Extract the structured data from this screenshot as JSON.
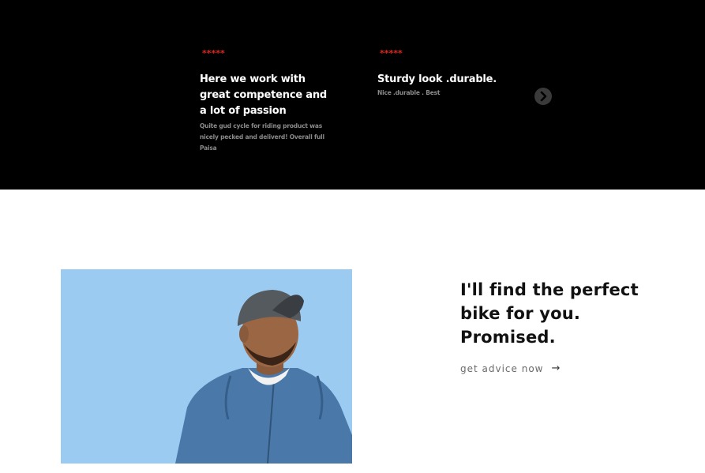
{
  "reviews": {
    "items": [
      {
        "stars": "*****",
        "title": "Here we work with great competence and a lot of passion",
        "text": "Quite gud cycle for riding product was nicely pecked and deliverd! Overall full Paisa"
      },
      {
        "stars": "*****",
        "title": "Sturdy look .durable.",
        "text": "Nice .durable . Best"
      }
    ],
    "next_icon": "chevron-right-circle-icon"
  },
  "promo": {
    "heading": "I'll find the perfect bike for you. Promised.",
    "link_label": "get advice now",
    "link_arrow": "→"
  },
  "colors": {
    "reviews_background": "#000000",
    "stars": "#e1261c",
    "image_sky": "#9ccbf2"
  }
}
